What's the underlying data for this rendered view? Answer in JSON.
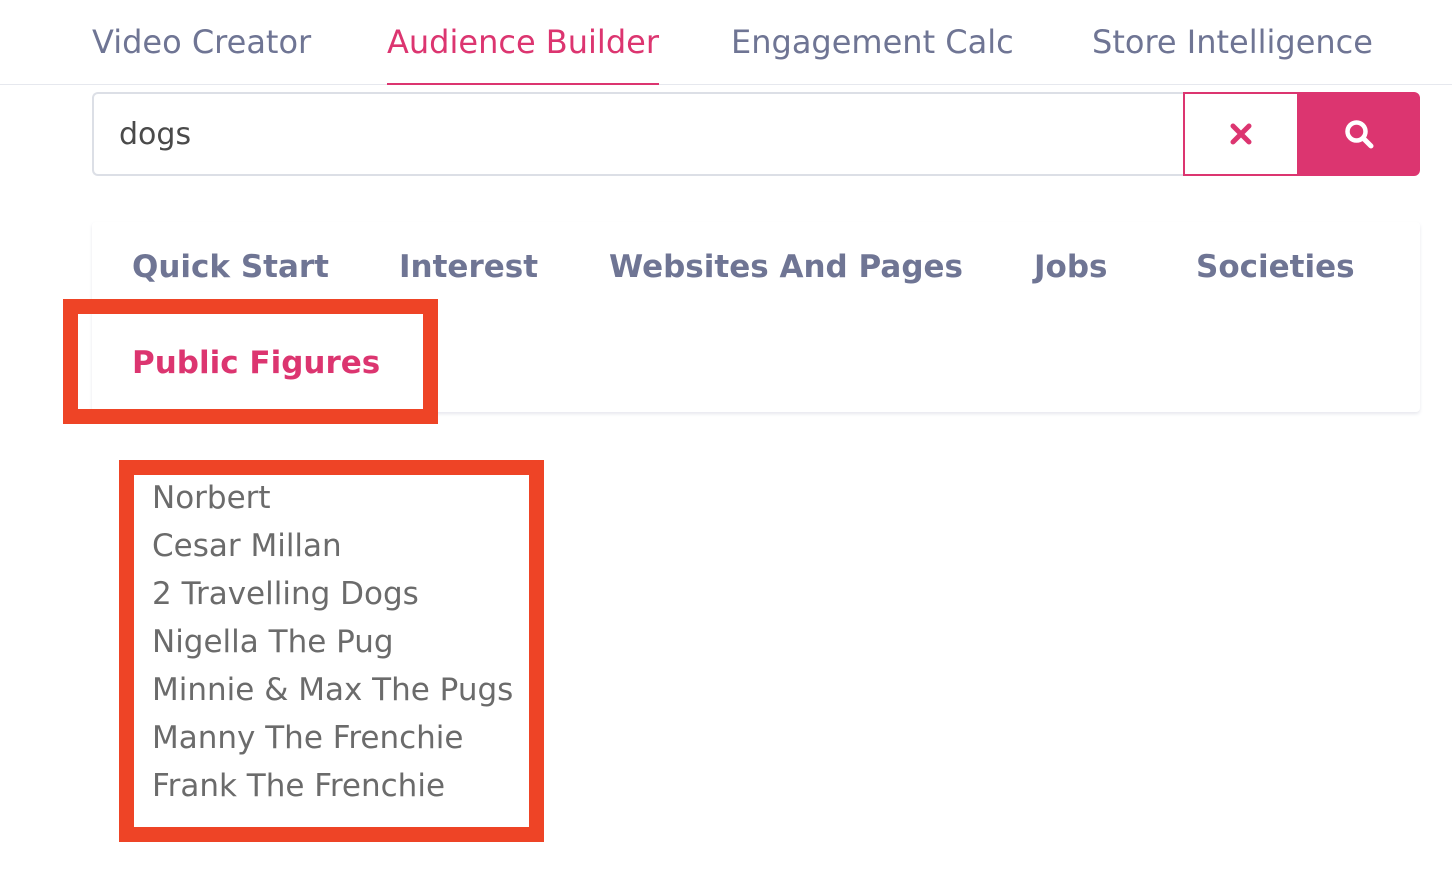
{
  "top_nav": {
    "tabs": [
      {
        "label": "Video Creator",
        "active": false
      },
      {
        "label": "Audience Builder",
        "active": true
      },
      {
        "label": "Engagement Calc",
        "active": false
      },
      {
        "label": "Store Intelligence",
        "active": false
      }
    ]
  },
  "search": {
    "value": "dogs",
    "clear_icon": "close-icon",
    "search_icon": "search-icon"
  },
  "sub_tabs": [
    {
      "label": "Quick Start",
      "active": false
    },
    {
      "label": "Interest",
      "active": false
    },
    {
      "label": "Websites And Pages",
      "active": false
    },
    {
      "label": "Jobs",
      "active": false
    },
    {
      "label": "Societies",
      "active": false
    },
    {
      "label": "Public Figures",
      "active": true
    }
  ],
  "results": [
    "Norbert",
    "Cesar Millan",
    "2 Travelling Dogs",
    "Nigella The Pug",
    "Minnie & Max The Pugs",
    "Manny The Frenchie",
    "Frank The Frenchie"
  ],
  "colors": {
    "accent": "#dc3570",
    "tab_text": "#6f7594",
    "result_text": "#6b6b6b",
    "highlight": "#ee4426"
  }
}
